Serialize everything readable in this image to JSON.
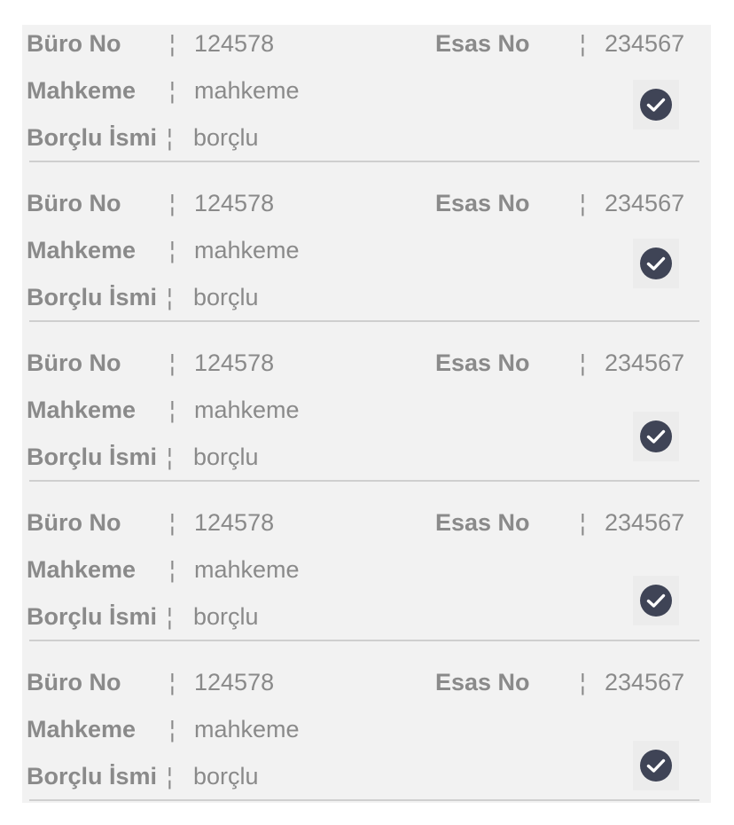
{
  "records": [
    {
      "buro_label": "Büro No",
      "buro_value": "124578",
      "esas_label": "Esas No",
      "esas_value": "234567",
      "mahkeme_label": "Mahkeme",
      "mahkeme_value": "mahkeme",
      "borclu_label": "Borçlu İsmi",
      "borclu_value": "borçlu",
      "separator": "¦",
      "checked": true
    },
    {
      "buro_label": "Büro No",
      "buro_value": "124578",
      "esas_label": "Esas No",
      "esas_value": "234567",
      "mahkeme_label": "Mahkeme",
      "mahkeme_value": "mahkeme",
      "borclu_label": "Borçlu İsmi",
      "borclu_value": "borçlu",
      "separator": "¦",
      "checked": true
    },
    {
      "buro_label": "Büro No",
      "buro_value": "124578",
      "esas_label": "Esas No",
      "esas_value": "234567",
      "mahkeme_label": "Mahkeme",
      "mahkeme_value": "mahkeme",
      "borclu_label": "Borçlu İsmi",
      "borclu_value": "borçlu",
      "separator": "¦",
      "checked": true
    },
    {
      "buro_label": "Büro No",
      "buro_value": "124578",
      "esas_label": "Esas No",
      "esas_value": "234567",
      "mahkeme_label": "Mahkeme",
      "mahkeme_value": "mahkeme",
      "borclu_label": "Borçlu İsmi",
      "borclu_value": "borçlu",
      "separator": "¦",
      "checked": true
    },
    {
      "buro_label": "Büro No",
      "buro_value": "124578",
      "esas_label": "Esas No",
      "esas_value": "234567",
      "mahkeme_label": "Mahkeme",
      "mahkeme_value": "mahkeme",
      "borclu_label": "Borçlu İsmi",
      "borclu_value": "borçlu",
      "separator": "¦",
      "checked": true
    }
  ],
  "colors": {
    "text": "#8a8a8a",
    "check_circle": "#3f4456",
    "check_mark": "#ffffff",
    "panel_bg": "#f2f2f2",
    "divider": "#cfcfcf"
  },
  "icons": {
    "check": "check-circle-icon"
  }
}
